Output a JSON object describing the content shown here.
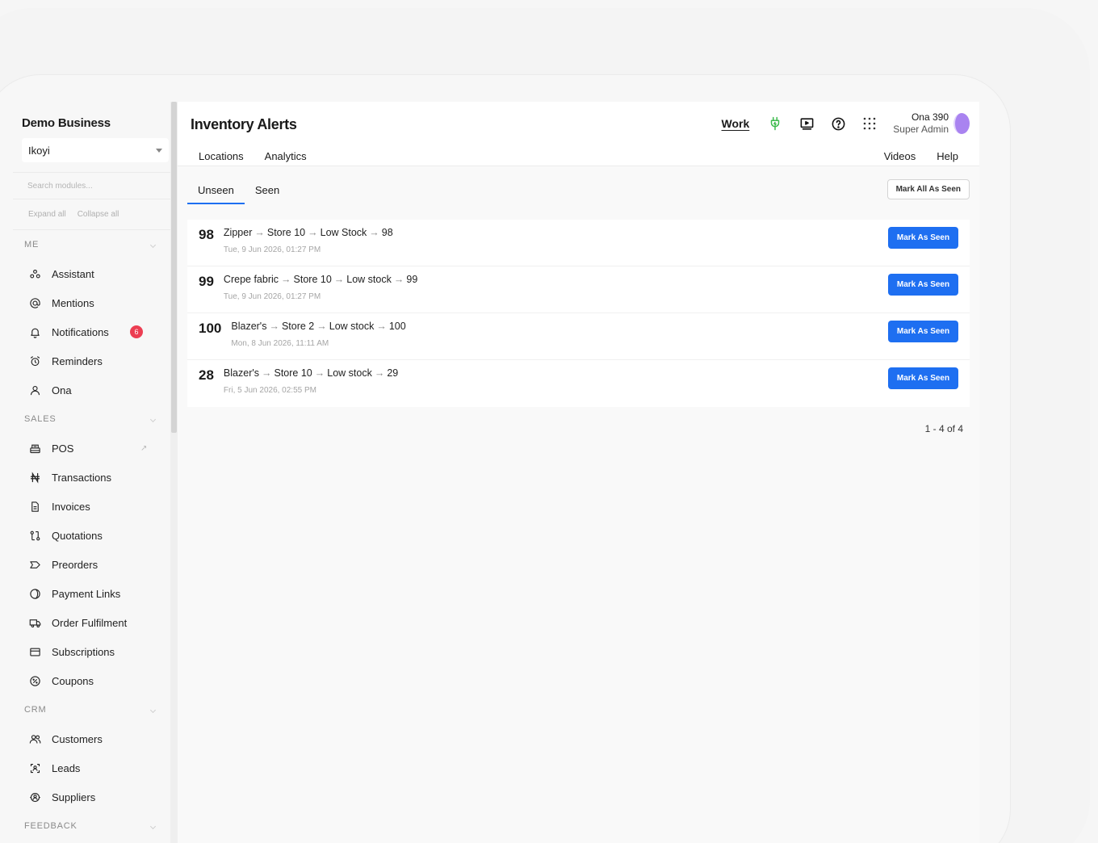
{
  "sidebar": {
    "business_name": "Demo Business",
    "location": "Ikoyi",
    "search_placeholder": "Search modules...",
    "expand_all": "Expand all",
    "collapse_all": "Collapse all",
    "sections": [
      {
        "label": "ME",
        "items": [
          {
            "label": "Assistant",
            "icon": "assistant-icon"
          },
          {
            "label": "Mentions",
            "icon": "at-icon"
          },
          {
            "label": "Notifications",
            "icon": "bell-icon",
            "badge": "6"
          },
          {
            "label": "Reminders",
            "icon": "alarm-clock-icon"
          },
          {
            "label": "Ona",
            "icon": "user-icon"
          }
        ]
      },
      {
        "label": "SALES",
        "items": [
          {
            "label": "POS",
            "icon": "register-icon",
            "external": "↗"
          },
          {
            "label": "Transactions",
            "icon": "naira-icon"
          },
          {
            "label": "Invoices",
            "icon": "document-icon"
          },
          {
            "label": "Quotations",
            "icon": "git-compare-icon"
          },
          {
            "label": "Preorders",
            "icon": "tag-icon"
          },
          {
            "label": "Payment Links",
            "icon": "coin-icon"
          },
          {
            "label": "Order Fulfilment",
            "icon": "truck-icon"
          },
          {
            "label": "Subscriptions",
            "icon": "card-icon"
          },
          {
            "label": "Coupons",
            "icon": "discount-icon"
          }
        ]
      },
      {
        "label": "CRM",
        "items": [
          {
            "label": "Customers",
            "icon": "users-icon"
          },
          {
            "label": "Leads",
            "icon": "scan-user-icon"
          },
          {
            "label": "Suppliers",
            "icon": "supplier-icon"
          }
        ]
      },
      {
        "label": "FEEDBACK",
        "items": []
      }
    ]
  },
  "header": {
    "title": "Inventory Alerts",
    "work_label": "Work",
    "user_name": "Ona 390",
    "user_role": "Super Admin",
    "subnav_left": [
      "Locations",
      "Analytics"
    ],
    "subnav_right": [
      "Videos",
      "Help"
    ],
    "plug_color": "#3dbb4d"
  },
  "tabs": [
    "Unseen",
    "Seen"
  ],
  "mark_all_label": "Mark All As Seen",
  "mark_seen_label": "Mark As Seen",
  "alerts": [
    {
      "qty": "98",
      "item": "Zipper",
      "store": "Store 10",
      "status": "Low Stock",
      "value": "98",
      "date": "Tue, 9 Jun 2026, 01:27 PM"
    },
    {
      "qty": "99",
      "item": "Crepe fabric",
      "store": "Store 10",
      "status": "Low stock",
      "value": "99",
      "date": "Tue, 9 Jun 2026, 01:27 PM"
    },
    {
      "qty": "100",
      "item": "Blazer's",
      "store": "Store 2",
      "status": "Low stock",
      "value": "100",
      "date": "Mon, 8 Jun 2026, 11:11 AM"
    },
    {
      "qty": "28",
      "item": "Blazer's",
      "store": "Store 10",
      "status": "Low stock",
      "value": "29",
      "date": "Fri, 5 Jun 2026, 02:55 PM"
    }
  ],
  "pagination": "1 - 4 of 4",
  "colors": {
    "accent": "#1e6ff1",
    "badge": "#ec3e52",
    "avatar": "#a983f0"
  }
}
